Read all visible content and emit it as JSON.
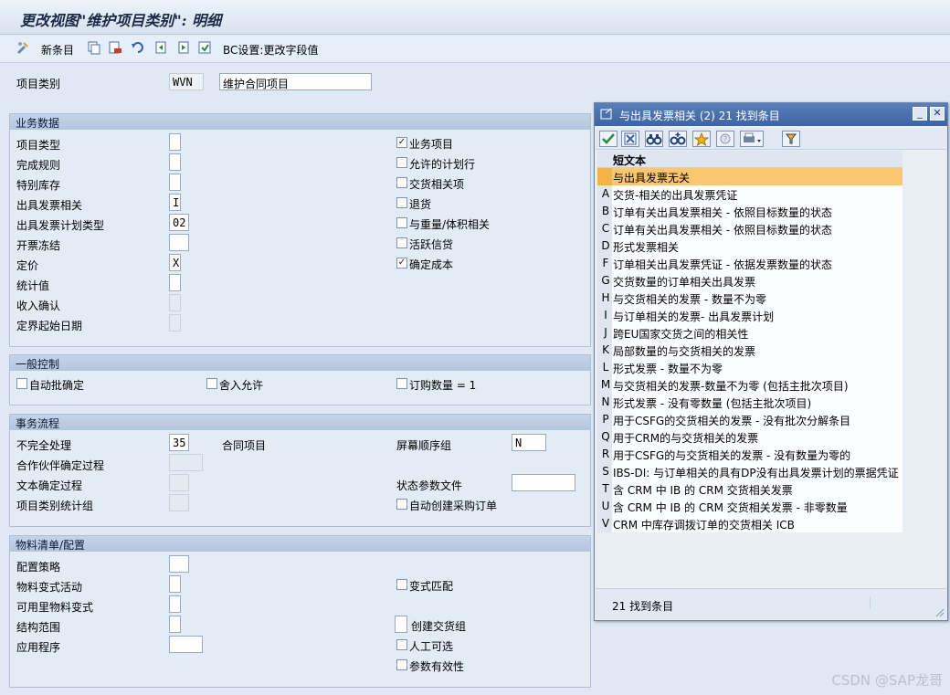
{
  "title": "更改视图\"维护项目类别\": 明细",
  "toolbar": {
    "new_entries": "新条目",
    "bc_settings": "BC设置:更改字段值"
  },
  "header": {
    "item_category_label": "项目类别",
    "item_category_value": "WVN",
    "item_category_desc": "维护合同项目"
  },
  "business_data": {
    "title": "业务数据",
    "left": [
      {
        "label": "项目类型",
        "value": ""
      },
      {
        "label": "完成规则",
        "value": ""
      },
      {
        "label": "特别库存",
        "value": ""
      },
      {
        "label": "出具发票相关",
        "value": "I"
      },
      {
        "label": "出具发票计划类型",
        "value": "02"
      },
      {
        "label": "开票冻结",
        "value": ""
      },
      {
        "label": "定价",
        "value": "X"
      },
      {
        "label": "统计值",
        "value": ""
      },
      {
        "label": "收入确认",
        "value": ""
      },
      {
        "label": "定界起始日期",
        "value": ""
      }
    ],
    "right": [
      {
        "label": "业务项目",
        "checked": true
      },
      {
        "label": "允许的计划行",
        "checked": false
      },
      {
        "label": "交货相关项",
        "checked": false
      },
      {
        "label": "退货",
        "checked": false
      },
      {
        "label": "与重量/体积相关",
        "checked": false
      },
      {
        "label": "活跃信贷",
        "checked": false
      },
      {
        "label": "确定成本",
        "checked": true
      }
    ]
  },
  "general_control": {
    "title": "一般控制",
    "auto_batch": "自动批确定",
    "rounding": "舍入允许",
    "order_qty": "订购数量 = 1"
  },
  "transaction_flow": {
    "title": "事务流程",
    "incompletion_label": "不完全处理",
    "incompletion_value": "35",
    "incompletion_desc": "合同项目",
    "screen_seq_label": "屏幕顺序组",
    "screen_seq_value": "N",
    "partner_label": "合作伙伴确定过程",
    "text_label": "文本确定过程",
    "status_profile_label": "状态参数文件",
    "item_stat_label": "项目类别统计组",
    "auto_po": "自动创建采购订单"
  },
  "bom": {
    "title": "物料清单/配置",
    "config_strategy": "配置策略",
    "variant_activity": "物料变式活动",
    "avail_variant": "可用里物料变式",
    "struct_scope": "结构范围",
    "application": "应用程序",
    "variant_match": "变式匹配",
    "create_delivery_group": "创建交货组",
    "manual_alt": "人工可选",
    "param_effectivity": "参数有效性"
  },
  "popup": {
    "title": "与出具发票相关 (2)   21 找到条目",
    "column_header": "短文本",
    "status": "21 找到条目",
    "rows": [
      {
        "key": "",
        "text": "与出具发票无关"
      },
      {
        "key": "A",
        "text": "交货-相关的出具发票凭证"
      },
      {
        "key": "B",
        "text": "订单有关出具发票相关 - 依照目标数量的状态"
      },
      {
        "key": "C",
        "text": "订单有关出具发票相关 - 依照目标数量的状态"
      },
      {
        "key": "D",
        "text": "形式发票相关"
      },
      {
        "key": "F",
        "text": "订单相关出具发票凭证 - 依据发票数量的状态"
      },
      {
        "key": "G",
        "text": "交货数量的订单相关出具发票"
      },
      {
        "key": "H",
        "text": "与交货相关的发票 - 数量不为零"
      },
      {
        "key": "I",
        "text": "与订单相关的发票- 出具发票计划"
      },
      {
        "key": "J",
        "text": "跨EU国家交货之间的相关性"
      },
      {
        "key": "K",
        "text": "局部数量的与交货相关的发票"
      },
      {
        "key": "L",
        "text": "形式发票 - 数量不为零"
      },
      {
        "key": "M",
        "text": "与交货相关的发票-数量不为零 (包括主批次项目)"
      },
      {
        "key": "N",
        "text": "形式发票 - 没有零数量 (包括主批次项目)"
      },
      {
        "key": "P",
        "text": "用于CSFG的交货相关的发票 - 没有批次分解条目"
      },
      {
        "key": "Q",
        "text": "用于CRM的与交货相关的发票"
      },
      {
        "key": "R",
        "text": "用于CSFG的与交货相关的发票 - 没有数量为零的"
      },
      {
        "key": "S",
        "text": "IBS-DI: 与订单相关的具有DP没有出具发票计划的票据凭证"
      },
      {
        "key": "T",
        "text": "含 CRM 中 IB 的 CRM 交货相关发票"
      },
      {
        "key": "U",
        "text": "含 CRM 中 IB 的 CRM 交货相关发票 - 非零数量"
      },
      {
        "key": "V",
        "text": "CRM 中库存调拨订单的交货相关 ICB"
      }
    ]
  },
  "watermark": "CSDN @SAP龙哥"
}
